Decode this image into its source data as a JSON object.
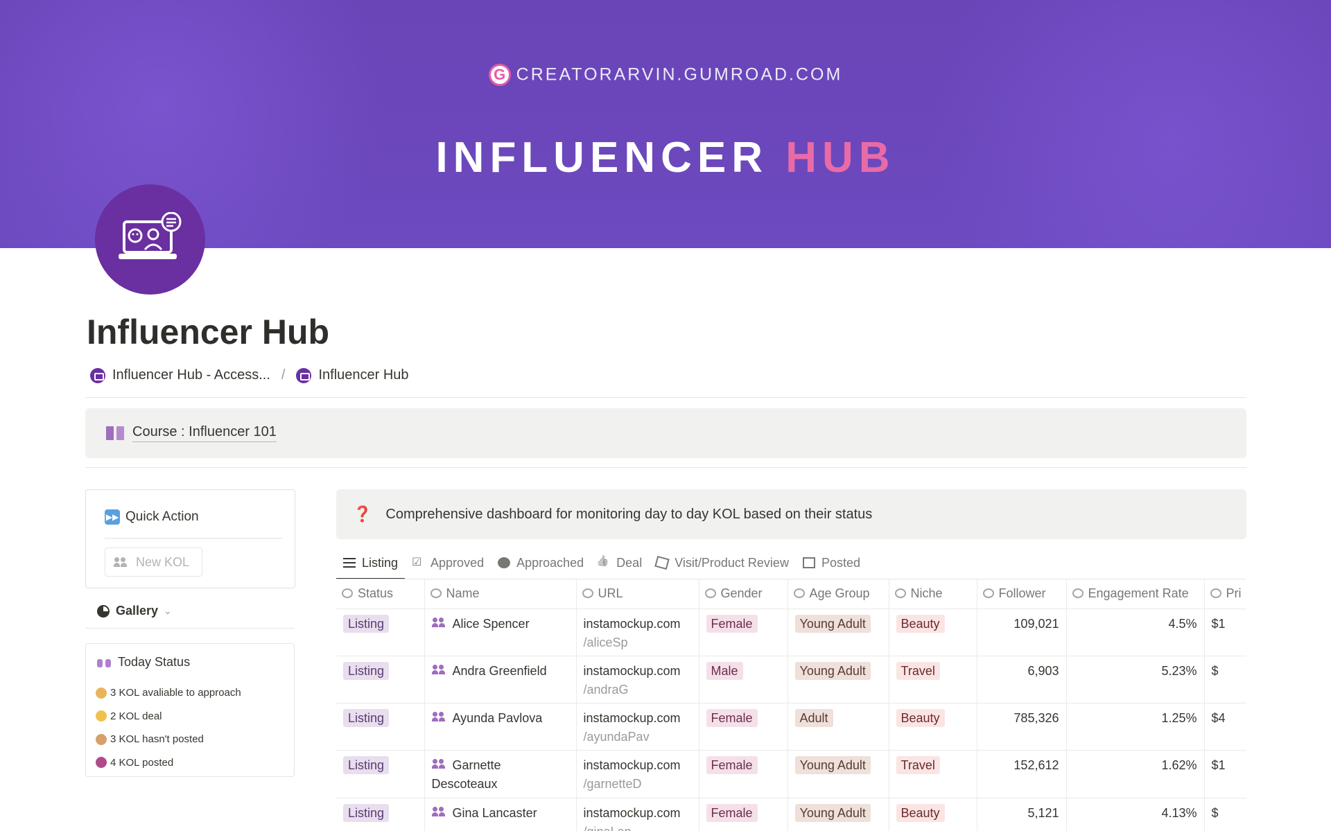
{
  "banner": {
    "gumroad_text": "CREATORARVIN.GUMROAD.COM",
    "gumroad_logo": "G",
    "hero_word1": "INFLUENCER",
    "hero_word2": "HUB"
  },
  "page": {
    "title": "Influencer Hub",
    "icon": "laptop-chat-icon"
  },
  "breadcrumb": {
    "items": [
      "Influencer Hub - Access...",
      "Influencer Hub"
    ],
    "separator": "/"
  },
  "course": {
    "icon": "book-icon",
    "label": "Course : Influencer 101"
  },
  "quick_action": {
    "title": "Quick Action",
    "button": "New KOL"
  },
  "gallery": {
    "label": "Gallery",
    "chevron": "⌄"
  },
  "today_status": {
    "title": "Today Status",
    "items": [
      "3 KOL avaliable to approach",
      "2 KOL deal",
      "3 KOL hasn't posted",
      "4 KOL posted"
    ]
  },
  "info": {
    "icon": "❓",
    "text": "Comprehensive dashboard for monitoring day to day KOL based on their status"
  },
  "tabs": [
    {
      "label": "Listing",
      "icon": "list-icon",
      "active": true
    },
    {
      "label": "Approved",
      "icon": "checklist-icon",
      "active": false
    },
    {
      "label": "Approached",
      "icon": "face-icon",
      "active": false
    },
    {
      "label": "Deal",
      "icon": "thumbs-up-icon",
      "active": false
    },
    {
      "label": "Visit/Product Review",
      "icon": "box-icon",
      "active": false
    },
    {
      "label": "Posted",
      "icon": "post-icon",
      "active": false
    }
  ],
  "table": {
    "columns": [
      "Status",
      "Name",
      "URL",
      "Gender",
      "Age Group",
      "Niche",
      "Follower",
      "Engagement Rate",
      "Pri"
    ],
    "rows": [
      {
        "status": "Listing",
        "name": "Alice Spencer",
        "url1": "instamockup.com",
        "url2": "/aliceSp",
        "gender": "Female",
        "age": "Young Adult",
        "niche": "Beauty",
        "follower": "109,021",
        "engagement": "4.5%",
        "price": "$1"
      },
      {
        "status": "Listing",
        "name": "Andra Greenfield",
        "url1": "instamockup.com",
        "url2": "/andraG",
        "gender": "Male",
        "age": "Young Adult",
        "niche": "Travel",
        "follower": "6,903",
        "engagement": "5.23%",
        "price": "$"
      },
      {
        "status": "Listing",
        "name": "Ayunda Pavlova",
        "url1": "instamockup.com",
        "url2": "/ayundaPav",
        "gender": "Female",
        "age": "Adult",
        "niche": "Beauty",
        "follower": "785,326",
        "engagement": "1.25%",
        "price": "$4"
      },
      {
        "status": "Listing",
        "name": "Garnette Descoteaux",
        "url1": "instamockup.com",
        "url2": "/garnetteD",
        "gender": "Female",
        "age": "Young Adult",
        "niche": "Travel",
        "follower": "152,612",
        "engagement": "1.62%",
        "price": "$1"
      },
      {
        "status": "Listing",
        "name": "Gina Lancaster",
        "url1": "instamockup.com",
        "url2": "/ginaLan",
        "gender": "Female",
        "age": "Young Adult",
        "niche": "Beauty",
        "follower": "5,121",
        "engagement": "4.13%",
        "price": "$"
      }
    ]
  },
  "colors": {
    "banner": "#6b47bb",
    "hub_pink": "#e86ba8",
    "icon_purple": "#6a2fa0"
  }
}
